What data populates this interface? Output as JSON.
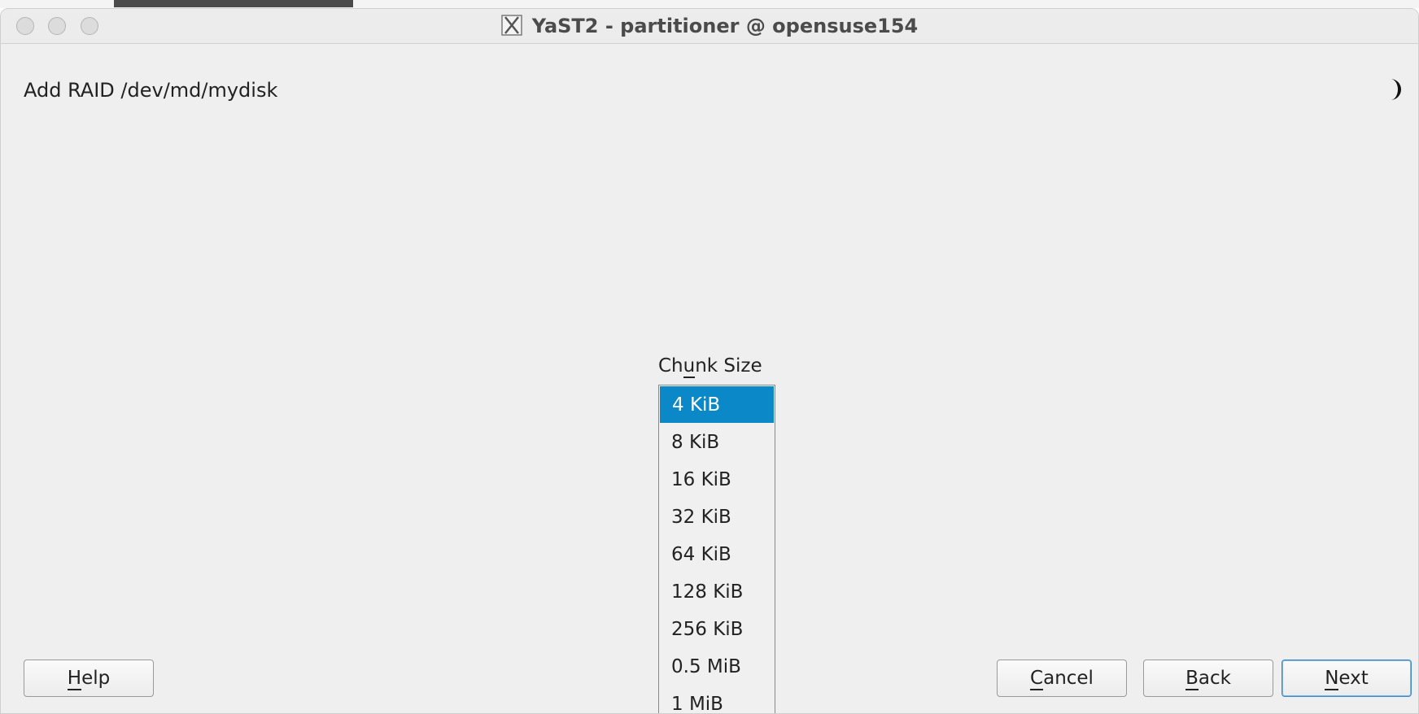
{
  "window": {
    "title": "YaST2 - partitioner @ opensuse154"
  },
  "dialog": {
    "title": "Add RAID /dev/md/mydisk"
  },
  "chunk_size": {
    "label_pre": "Ch",
    "label_mnemonic": "u",
    "label_post": "nk Size",
    "selected": "4 KiB",
    "options": [
      "4 KiB",
      "8 KiB",
      "16 KiB",
      "32 KiB",
      "64 KiB",
      "128 KiB",
      "256 KiB",
      "0.5 MiB",
      "1 MiB"
    ]
  },
  "buttons": {
    "help": {
      "mnemonic": "H",
      "rest": "elp"
    },
    "cancel": {
      "mnemonic": "C",
      "rest": "ancel"
    },
    "back": {
      "mnemonic": "B",
      "rest": "ack"
    },
    "next": {
      "mnemonic": "N",
      "rest": "ext"
    }
  },
  "colors": {
    "selection": "#0a88c8",
    "default_button_border": "#3d89c6"
  },
  "icons": [
    "x-window-icon",
    "moon-busy-icon"
  ]
}
